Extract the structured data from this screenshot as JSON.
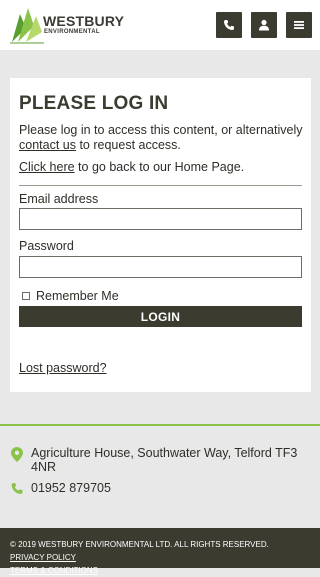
{
  "header": {
    "logo_word": "WESTBURY",
    "logo_sub": "ENVIRONMENTAL",
    "buttons": [
      "phone-icon",
      "user-icon",
      "menu-icon"
    ],
    "brand_green": "#8bc34a",
    "dark": "#3b3b2f"
  },
  "login": {
    "title": "PLEASE LOG IN",
    "intro_pre": "Please log in to access this content, or alternatively ",
    "intro_link": "contact us",
    "intro_post": " to request access.",
    "back_link": "Click here",
    "back_post": " to go back to our Home Page.",
    "email_label": "Email address",
    "email_value": "",
    "password_label": "Password",
    "password_value": "",
    "remember_label": "Remember Me",
    "remember_checked": false,
    "submit_label": "LOGIN",
    "lost_password": "Lost password?"
  },
  "contact": {
    "address": "Agriculture House, Southwater Way, Telford TF3 4NR",
    "phone": "01952 879705"
  },
  "footer": {
    "copyright": "© 2019 WESTBURY ENVIRONMENTAL LTD. ALL RIGHTS RESERVED.",
    "privacy": "PRIVACY POLICY",
    "terms": "TERMS & CONDITIONS"
  }
}
